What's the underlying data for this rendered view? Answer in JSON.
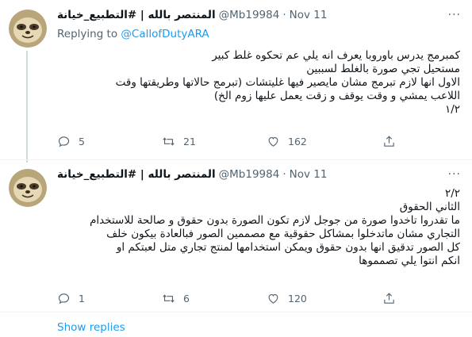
{
  "tweets": [
    {
      "display_name": "المنتصر بالله | #التطبيع_خيانة",
      "handle": "@Mb19984",
      "separator": "·",
      "date": "Nov 11",
      "more": "···",
      "replying_prefix": "Replying to ",
      "replying_to": "@CallofDutyARA",
      "lines": [
        "كمبرمج يدرس باوروبا يعرف انه يلي عم تحكوه غلط كبير",
        "مستحيل تجي صورة بالغلط لسببين",
        "الاول انها لازم تبرمج مشان مايصير فيها غليتشات (تبرمج حالاتها وطريقتها وقت",
        "اللاعب يمشي و وقت يوقف و زقت يعمل عليها زوم الخ)",
        "١/٢"
      ],
      "reply_count": "5",
      "retweet_count": "21",
      "like_count": "162"
    },
    {
      "display_name": "المنتصر بالله | #التطبيع_خيانة",
      "handle": "@Mb19984",
      "separator": "·",
      "date": "Nov 11",
      "more": "···",
      "lines": [
        "٢/٢",
        "الثاني الحقوق",
        "ما تقدروا تاخدوا صورة من جوجل لازم تكون الصورة بدون حقوق و صالحة للاستخدام",
        "التجاري مشان ماتدخلوا بمشاكل حقوقية مع مصممين الصور فبالعادة بيكون خلف",
        "كل الصور تدقيق انها بدون حقوق ويمكن استخدامها لمنتج تجاري متل لعبتكم او",
        "انكم انتوا يلي تصمموها"
      ],
      "reply_count": "1",
      "retweet_count": "6",
      "like_count": "120"
    }
  ],
  "show_replies": "Show replies",
  "colors": {
    "accent": "#1d9bf0",
    "muted": "#536471",
    "text": "#0f1419",
    "line": "#cfd9de"
  },
  "icons": [
    "reply-icon",
    "retweet-icon",
    "like-icon",
    "share-icon",
    "more-icon"
  ]
}
